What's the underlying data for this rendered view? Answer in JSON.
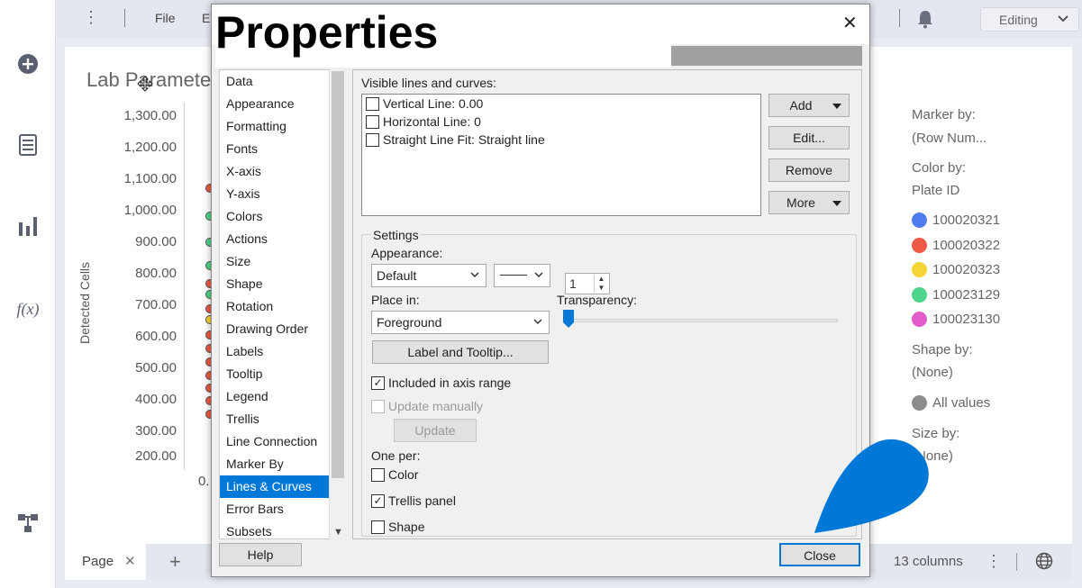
{
  "topbar": {
    "file": "File",
    "file_cut": "E",
    "editing": "Editing"
  },
  "chart": {
    "title": "Lab Paramete",
    "ylabel": "Detected Cells",
    "yticks": [
      "1,300.00",
      "1,200.00",
      "1,100.00",
      "1,000.00",
      "900.00",
      "800.00",
      "700.00",
      "600.00",
      "500.00",
      "400.00",
      "300.00",
      "200.00"
    ],
    "xtick": "0."
  },
  "legend": {
    "marker_by_label": "Marker by:",
    "marker_by_value": "(Row Num...",
    "color_by_label": "Color by:",
    "color_by_value": "Plate ID",
    "items": [
      {
        "label": "100020321",
        "color": "#4f7df0"
      },
      {
        "label": "100020322",
        "color": "#ef5a45"
      },
      {
        "label": "100020323",
        "color": "#f5d535"
      },
      {
        "label": "100023129",
        "color": "#4fd68c"
      },
      {
        "label": "100023130",
        "color": "#e25ccd"
      }
    ],
    "shape_by_label": "Shape by:",
    "shape_by_value": "(None)",
    "all_values": "All values",
    "size_by_label": "Size by:",
    "size_by_value": "(None)"
  },
  "bottombar": {
    "page_tab": "Page",
    "columns": "13 columns"
  },
  "dialog": {
    "title": "Properties",
    "nav": [
      "Data",
      "Appearance",
      "Formatting",
      "Fonts",
      "X-axis",
      "Y-axis",
      "Colors",
      "Actions",
      "Size",
      "Shape",
      "Rotation",
      "Drawing Order",
      "Labels",
      "Tooltip",
      "Legend",
      "Trellis",
      "Line Connection",
      "Marker By",
      "Lines & Curves",
      "Error Bars",
      "Subsets"
    ],
    "selected_nav": "Lines & Curves",
    "visible_lines_label": "Visible lines and curves:",
    "lines": [
      "Vertical Line: 0.00",
      "Horizontal Line: 0",
      "Straight Line Fit: Straight line"
    ],
    "add": "Add",
    "edit": "Edit...",
    "remove": "Remove",
    "more": "More",
    "settings": "Settings",
    "appearance_label": "Appearance:",
    "appearance_value": "Default",
    "line_width": "1",
    "place_in_label": "Place in:",
    "place_in_value": "Foreground",
    "transparency_label": "Transparency:",
    "label_tooltip": "Label and Tooltip...",
    "included_in_axis": "Included in axis range",
    "update_manually": "Update manually",
    "update": "Update",
    "one_per": "One per:",
    "one_per_color": "Color",
    "one_per_trellis": "Trellis panel",
    "one_per_shape": "Shape",
    "help": "Help",
    "close": "Close"
  },
  "colors": {
    "accent": "#0078d7"
  }
}
